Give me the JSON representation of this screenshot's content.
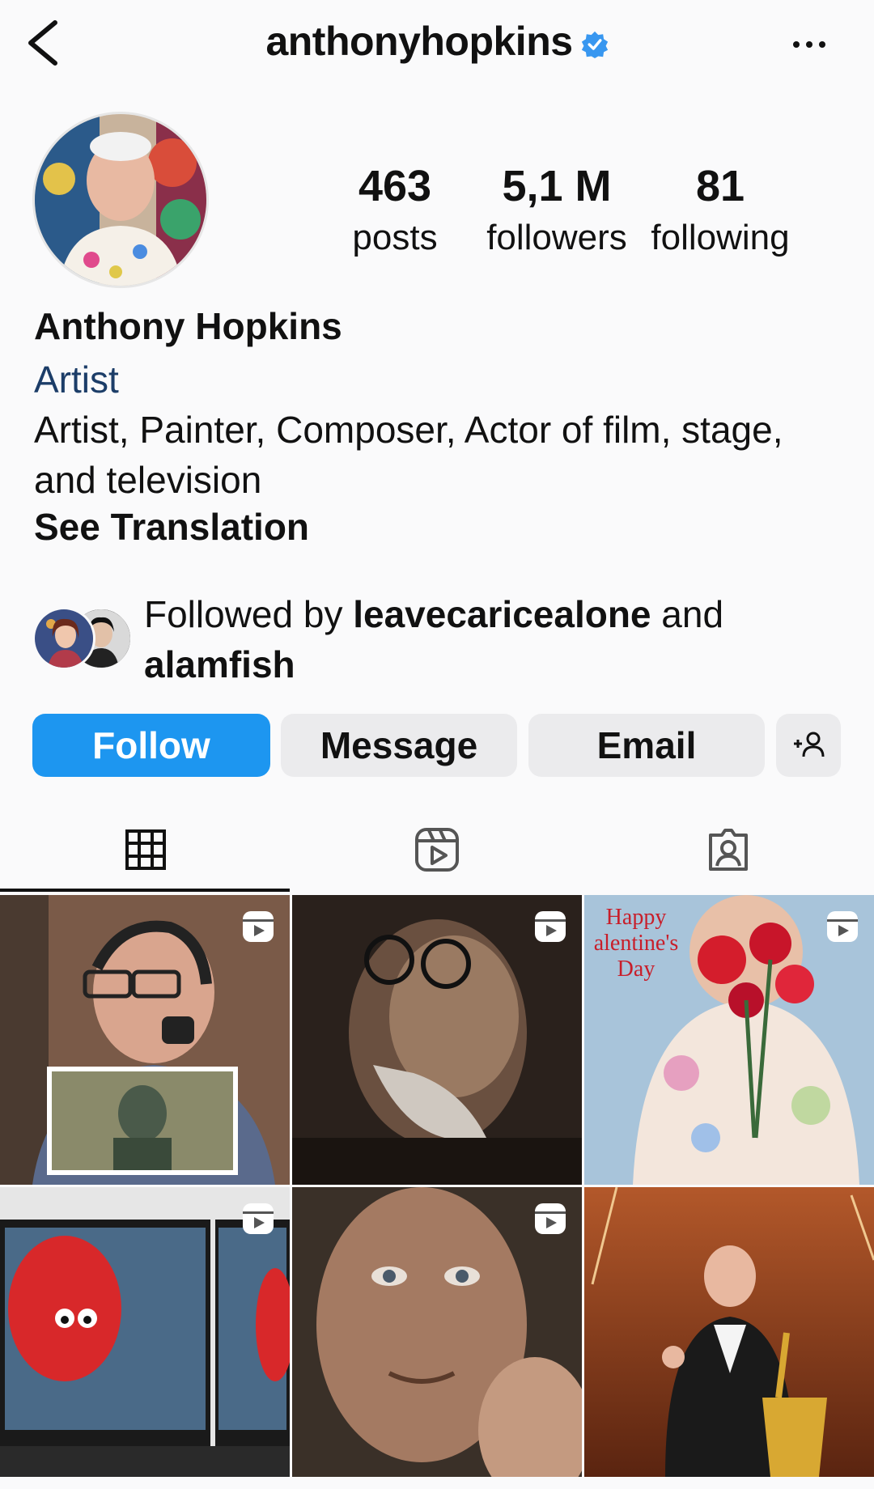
{
  "header": {
    "username": "anthonyhopkins",
    "back_icon": "chevron-left-icon",
    "verified_icon": "verified-badge-icon",
    "more_icon": "more-horizontal-icon"
  },
  "stats": {
    "posts": {
      "value": "463",
      "label": "posts"
    },
    "followers": {
      "value": "5,1 M",
      "label": "followers"
    },
    "following": {
      "value": "81",
      "label": "following"
    }
  },
  "profile": {
    "display_name": "Anthony Hopkins",
    "category": "Artist",
    "bio": "Artist, Painter, Composer, Actor of film, stage, and television",
    "see_translation": "See Translation"
  },
  "followed_by": {
    "prefix": "Followed by ",
    "user1": "leavecaricealone",
    "middle": " and",
    "user2": "alamfish"
  },
  "actions": {
    "follow": "Follow",
    "message": "Message",
    "email": "Email",
    "suggest_icon": "add-person-icon"
  },
  "tabs": {
    "active": "grid",
    "items": [
      "grid-icon",
      "reels-icon",
      "tagged-icon"
    ]
  },
  "grid": {
    "posts": [
      {
        "kind": "reel"
      },
      {
        "kind": "reel"
      },
      {
        "kind": "reel",
        "overlay_text": [
          "Happy",
          "alentine's",
          "Day"
        ]
      },
      {
        "kind": "reel"
      },
      {
        "kind": "reel"
      },
      {
        "kind": "photo"
      }
    ]
  },
  "colors": {
    "accent": "#1d96f0",
    "category_text": "#1c3d68",
    "verified": "#3897f0",
    "background": "#fafafb"
  }
}
